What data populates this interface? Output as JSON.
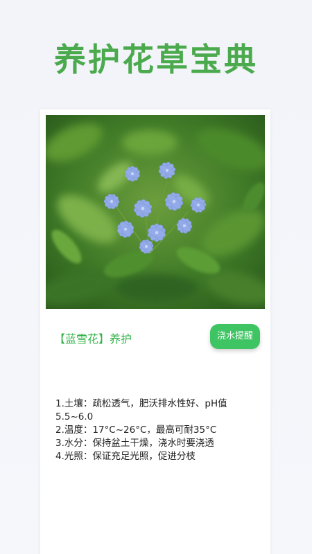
{
  "app": {
    "title": "养护花草宝典"
  },
  "card": {
    "image": {
      "subject": "blue plumbago flower cluster",
      "colors": {
        "flower": "#8fa9e6",
        "leaves": "#3d7a28"
      }
    },
    "care_title": "【蓝雪花】养护",
    "water_button": {
      "label": "浇水提醒",
      "color": "#3ec463"
    },
    "care_items": [
      "1.土壤：疏松透气，肥沃排水性好、pH值5.5~6.0",
      "2.温度：17°C~26°C，最高可耐35°C",
      "3.水分：保持盆土干燥，浇水时要浇透",
      "4.光照：保证充足光照，促进分枝"
    ]
  }
}
